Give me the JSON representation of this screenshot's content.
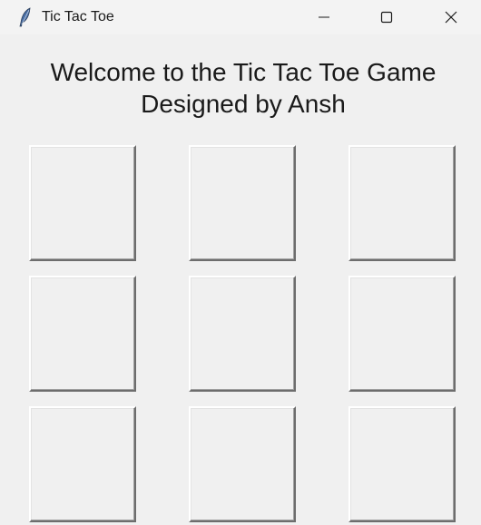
{
  "window": {
    "title": "Tic Tac Toe",
    "icon": "feather-icon",
    "controls": {
      "minimize": "minimize-icon",
      "maximize": "maximize-icon",
      "close": "close-icon"
    }
  },
  "heading": {
    "line1": "Welcome to the Tic Tac Toe Game",
    "line2": "Designed by Ansh"
  },
  "board": {
    "cells": [
      "",
      "",
      "",
      "",
      "",
      "",
      "",
      "",
      ""
    ]
  }
}
